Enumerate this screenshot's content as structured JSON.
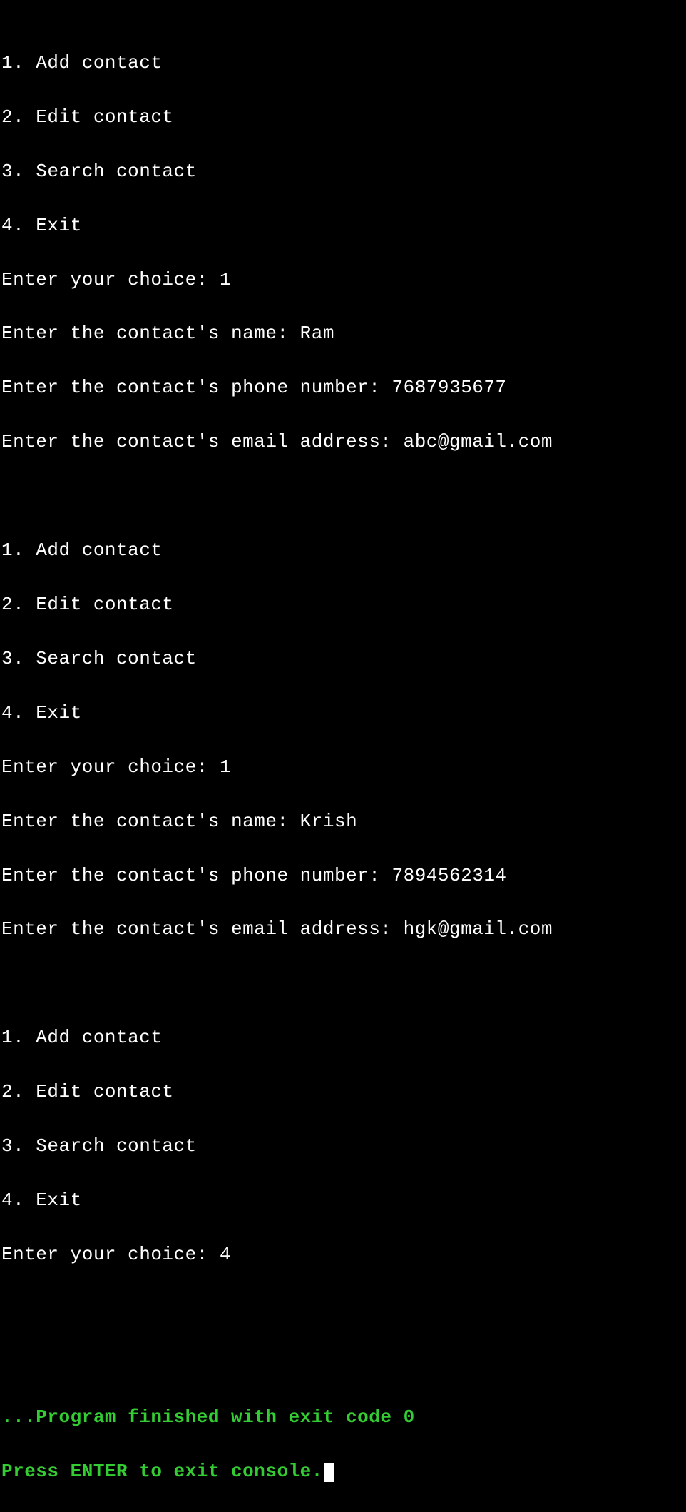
{
  "menu": {
    "item1": "1. Add contact",
    "item2": "2. Edit contact",
    "item3": "3. Search contact",
    "item4": "4. Exit"
  },
  "prompts": {
    "choice": "Enter your choice: ",
    "name": "Enter the contact's name: ",
    "phone": "Enter the contact's phone number: ",
    "email": "Enter the contact's email address: "
  },
  "session1": {
    "choice": "1",
    "name": "Ram",
    "phone": "7687935677",
    "email": "abc@gmail.com"
  },
  "session2": {
    "choice": "1",
    "name": "Krish",
    "phone": "7894562314",
    "email": "hgk@gmail.com"
  },
  "session3": {
    "choice": "4"
  },
  "footer": {
    "finished": "...Program finished with exit code 0",
    "press_enter": "Press ENTER to exit console."
  }
}
